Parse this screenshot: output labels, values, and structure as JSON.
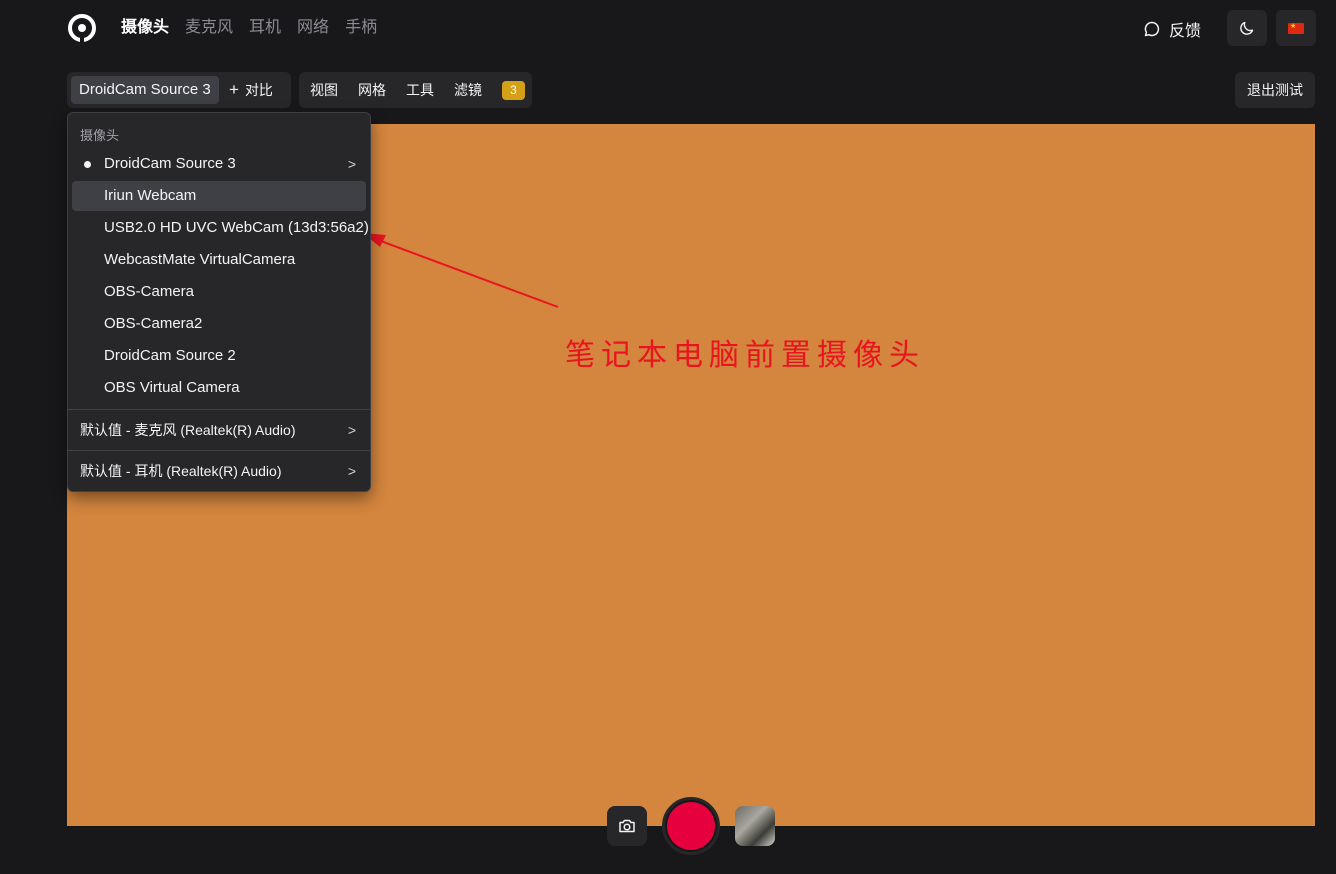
{
  "nav": {
    "tabs": [
      "摄像头",
      "麦克风",
      "耳机",
      "网络",
      "手柄"
    ],
    "active": 0
  },
  "header": {
    "feedback_label": "反馈",
    "theme_icon": "moon-icon",
    "lang_icon": "china-flag-icon"
  },
  "toolbar": {
    "source_label": "DroidCam Source 3",
    "compare_label": "对比",
    "view_label": "视图",
    "grid_label": "网格",
    "tools_label": "工具",
    "filter_label": "滤镜",
    "filter_count": "3",
    "exit_label": "退出测试"
  },
  "dropdown": {
    "header": "摄像头",
    "items": [
      "DroidCam Source 3",
      "Iriun Webcam",
      "USB2.0 HD UVC WebCam (13d3:56a2)",
      "WebcastMate VirtualCamera",
      "OBS-Camera",
      "OBS-Camera2",
      "DroidCam Source 2",
      "OBS Virtual Camera"
    ],
    "selected": 0,
    "hovered": 1,
    "mic_label": "默认值 - 麦克风 (Realtek(R) Audio)",
    "headphone_label": "默认值 - 耳机 (Realtek(R) Audio)"
  },
  "annotation": {
    "text": "笔记本电脑前置摄像头",
    "color": "#e8141f"
  },
  "colors": {
    "background": "#18181b",
    "preview": "#d4853e",
    "record": "#e6003d",
    "badge": "#d4a017"
  }
}
